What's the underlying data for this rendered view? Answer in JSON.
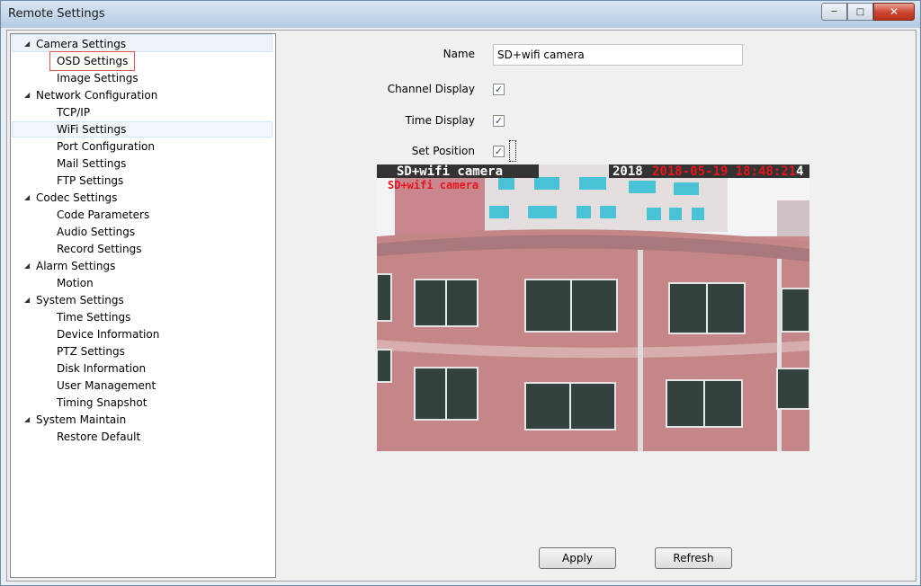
{
  "window": {
    "title": "Remote Settings"
  },
  "tree": {
    "groups": [
      {
        "label": "Camera Settings",
        "children": [
          "OSD Settings",
          "Image Settings"
        ]
      },
      {
        "label": "Network Configuration",
        "children": [
          "TCP/IP",
          "WiFi Settings",
          "Port Configuration",
          "Mail Settings",
          "FTP Settings"
        ]
      },
      {
        "label": "Codec Settings",
        "children": [
          "Code Parameters",
          "Audio Settings",
          "Record Settings"
        ]
      },
      {
        "label": "Alarm Settings",
        "children": [
          "Motion"
        ]
      },
      {
        "label": "System Settings",
        "children": [
          "Time Settings",
          "Device Information",
          "PTZ Settings",
          "Disk Information",
          "User Management",
          "Timing Snapshot"
        ]
      },
      {
        "label": "System Maintain",
        "children": [
          "Restore Default"
        ]
      }
    ],
    "selected": "OSD Settings",
    "hovered": "WiFi Settings"
  },
  "form": {
    "name_label": "Name",
    "name_value": "SD+wifi camera",
    "channel_display_label": "Channel Display",
    "channel_display_checked": true,
    "time_display_label": "Time Display",
    "time_display_checked": true,
    "set_position_label": "Set Position",
    "set_position_checked": true
  },
  "preview": {
    "osd_channel_white": "SD+wifi camera",
    "osd_channel_red": "SD+wifi camera",
    "osd_time_white": "2018",
    "osd_time_red": "2018-05-19 18:48:21",
    "osd_time_white_tail": "4"
  },
  "buttons": {
    "apply": "Apply",
    "refresh": "Refresh"
  },
  "colors": {
    "osd_red": "#e8141c",
    "selection_border": "#d9534f"
  }
}
